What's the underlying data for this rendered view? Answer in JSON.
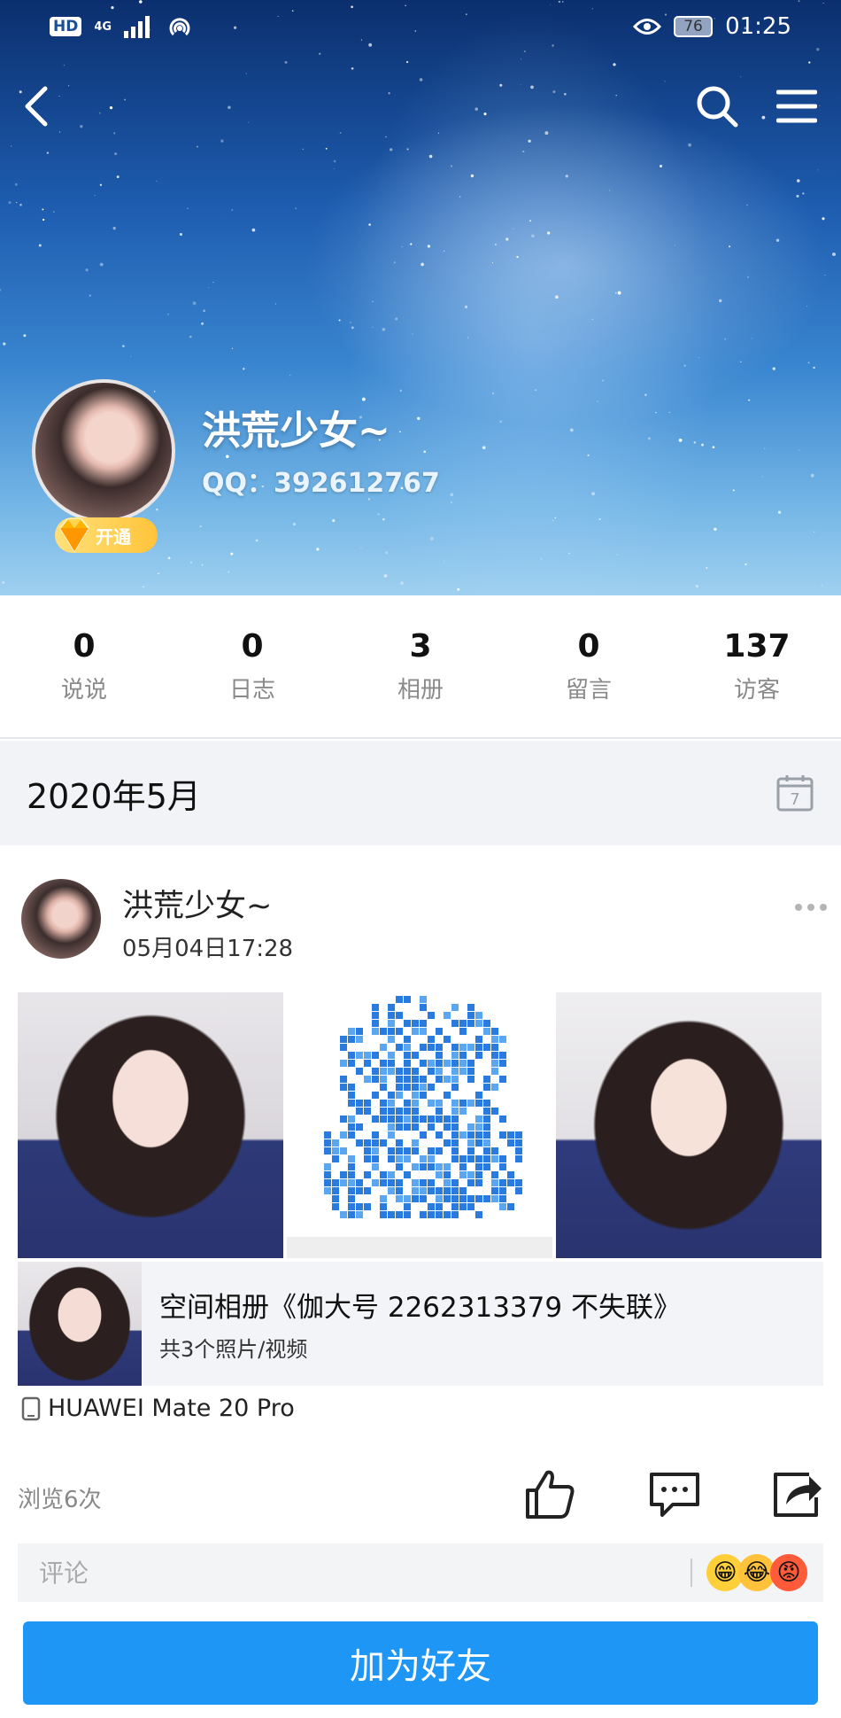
{
  "status_bar": {
    "hd": "HD",
    "network": "4G",
    "battery": "76",
    "time": "01:25"
  },
  "nav": {
    "back_icon": "chevron-left-icon",
    "search_icon": "search-icon",
    "menu_icon": "hamburger-menu-icon"
  },
  "profile": {
    "name": "洪荒少女~",
    "qq": "QQ：392612767",
    "vip_label": "开通"
  },
  "stats": [
    {
      "value": "0",
      "label": "说说"
    },
    {
      "value": "0",
      "label": "日志"
    },
    {
      "value": "3",
      "label": "相册"
    },
    {
      "value": "0",
      "label": "留言"
    },
    {
      "value": "137",
      "label": "访客"
    }
  ],
  "timeline": {
    "date": "2020年5月",
    "calendar_day": "7"
  },
  "post": {
    "author": "洪荒少女~",
    "time": "05月04日17:28",
    "album_title": "空间相册《伽大号 2262313379 不失联》",
    "album_count": "共3个照片/视频",
    "device": "HUAWEI Mate 20 Pro",
    "views": "浏览6次",
    "comment_placeholder": "评论",
    "emojis": [
      "😁",
      "😂",
      "😡"
    ]
  },
  "add_friend_label": "加为好友",
  "colors": {
    "accent": "#1e96f5",
    "sky_top": "#0b2f6e",
    "sky_bottom": "#9fd0f0",
    "vip_gold": "#ffc43a"
  }
}
